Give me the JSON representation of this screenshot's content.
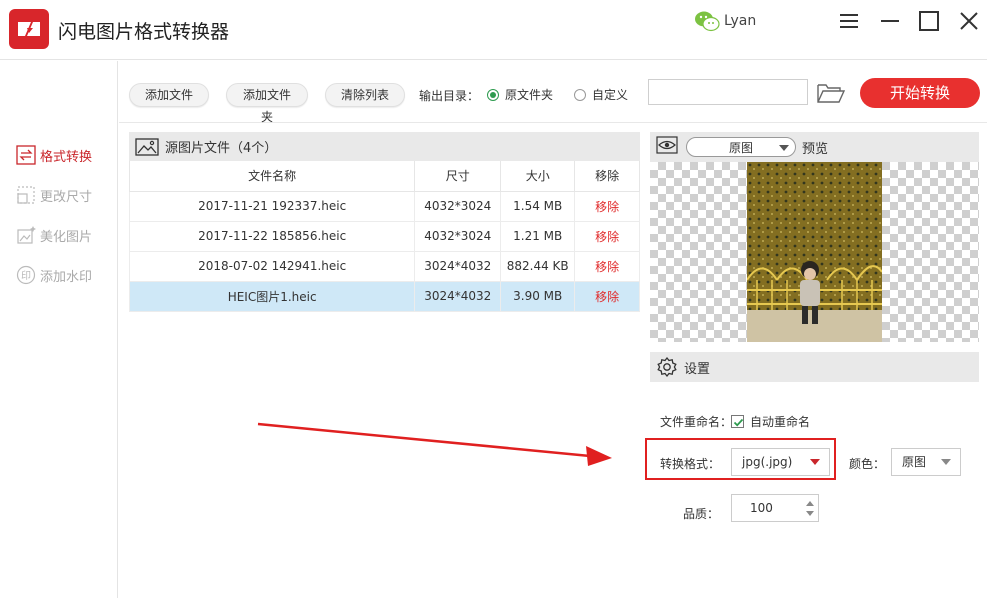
{
  "app": {
    "title": "闪电图片格式转换器",
    "user": "Lyan",
    "accent": "#e8302f"
  },
  "sidebar": {
    "items": [
      {
        "label": "格式转换",
        "icon": "swap-icon",
        "active": true
      },
      {
        "label": "更改尺寸",
        "icon": "resize-icon",
        "active": false
      },
      {
        "label": "美化图片",
        "icon": "beautify-icon",
        "active": false
      },
      {
        "label": "添加水印",
        "icon": "watermark-icon",
        "active": false
      }
    ]
  },
  "toolbar": {
    "add_file": "添加文件",
    "add_folder": "添加文件夹",
    "clear_list": "清除列表",
    "output_label": "输出目录：",
    "radio_original": "原文件夹",
    "radio_custom": "自定义",
    "path_value": "",
    "start": "开始转换"
  },
  "files": {
    "header": "源图片文件（4个）",
    "columns": [
      "文件名称",
      "尺寸",
      "大小",
      "移除"
    ],
    "rows": [
      {
        "name": "2017-11-21 192337.heic",
        "size": "4032*3024",
        "bytes": "1.54 MB",
        "remove": "移除"
      },
      {
        "name": "2017-11-22 185856.heic",
        "size": "4032*3024",
        "bytes": "1.21 MB",
        "remove": "移除"
      },
      {
        "name": "2018-07-02 142941.heic",
        "size": "3024*4032",
        "bytes": "882.44 KB",
        "remove": "移除"
      },
      {
        "name": "HEIC图片1.heic",
        "size": "3024*4032",
        "bytes": "3.90 MB",
        "remove": "移除"
      }
    ]
  },
  "preview": {
    "mode": "原图",
    "label": "预览"
  },
  "settings": {
    "header": "设置",
    "rename_label": "文件重命名：",
    "rename_option": "自动重命名",
    "format_label": "转换格式：",
    "format_value": "jpg(.jpg)",
    "color_label": "颜色：",
    "color_value": "原图",
    "quality_label": "品质：",
    "quality_value": "100"
  }
}
